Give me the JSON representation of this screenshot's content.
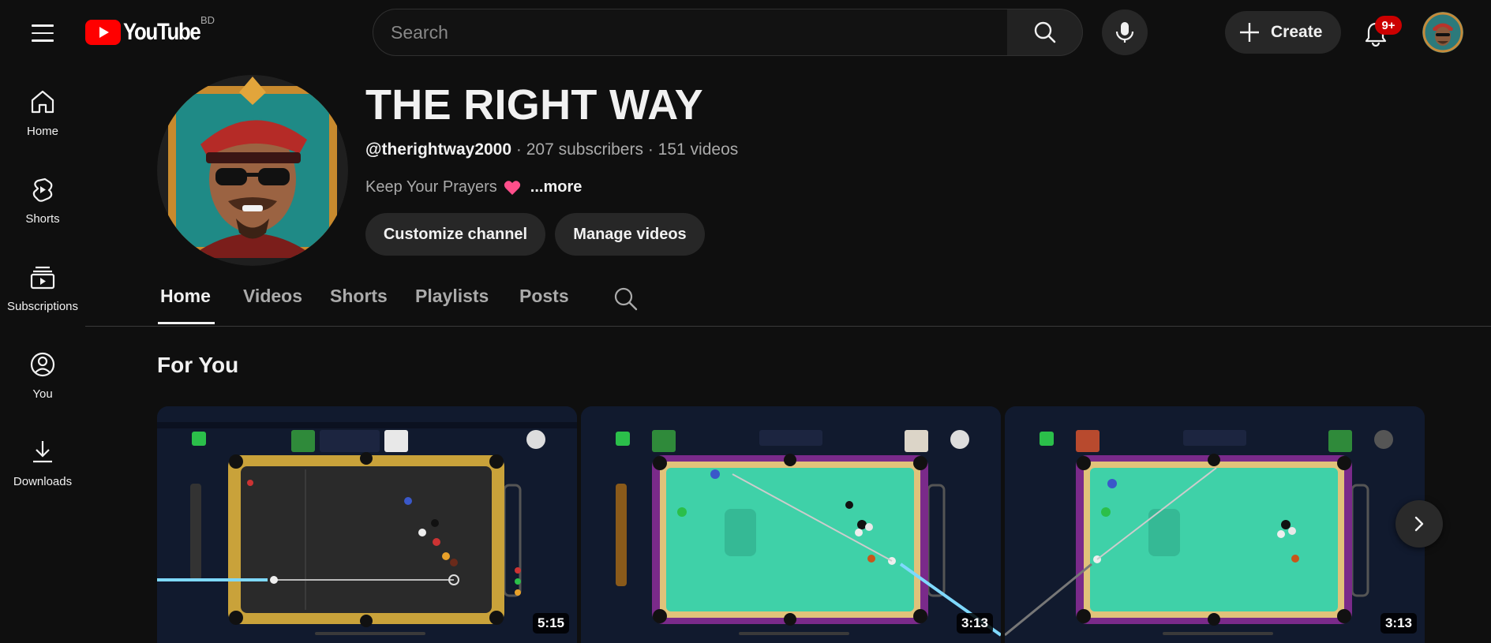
{
  "header": {
    "logo_text": "YouTube",
    "country_code": "BD",
    "search_placeholder": "Search",
    "create_label": "Create",
    "notification_count": "9+"
  },
  "guide": {
    "items": [
      {
        "label": "Home",
        "icon": "home-icon"
      },
      {
        "label": "Shorts",
        "icon": "shorts-icon"
      },
      {
        "label": "Subscriptions",
        "icon": "subscriptions-icon"
      },
      {
        "label": "You",
        "icon": "you-icon"
      },
      {
        "label": "Downloads",
        "icon": "download-icon"
      }
    ]
  },
  "channel": {
    "title": "THE RIGHT WAY",
    "handle": "@therightway2000",
    "subscribers": "207 subscribers",
    "videos_count": "151 videos",
    "separator": "·",
    "description": "Keep Your Prayers",
    "description_emoji": "heart-icon",
    "more_label": "...more",
    "customize_label": "Customize channel",
    "manage_label": "Manage videos"
  },
  "tabs": [
    {
      "label": "Home",
      "active": true
    },
    {
      "label": "Videos",
      "active": false
    },
    {
      "label": "Shorts",
      "active": false
    },
    {
      "label": "Playlists",
      "active": false
    },
    {
      "label": "Posts",
      "active": false
    }
  ],
  "section": {
    "title": "For You",
    "videos": [
      {
        "duration": "5:15",
        "table": "dark"
      },
      {
        "duration": "3:13",
        "table": "green"
      },
      {
        "duration": "3:13",
        "table": "green"
      }
    ]
  },
  "colors": {
    "background": "#0f0f0f",
    "brand_red": "#ff0000",
    "badge_red": "#cc0000",
    "pill_bg": "#272727",
    "table_green": "#3fd1a8",
    "table_dark": "#2a2a2a"
  }
}
